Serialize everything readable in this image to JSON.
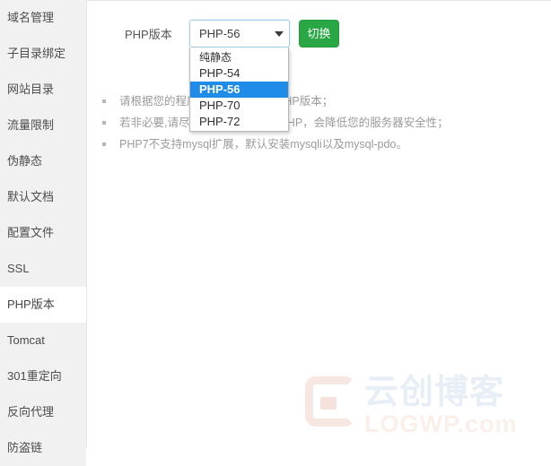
{
  "sidebar": {
    "items": [
      {
        "label": "域名管理",
        "active": false
      },
      {
        "label": "子目录绑定",
        "active": false
      },
      {
        "label": "网站目录",
        "active": false
      },
      {
        "label": "流量限制",
        "active": false
      },
      {
        "label": "伪静态",
        "active": false
      },
      {
        "label": "默认文档",
        "active": false
      },
      {
        "label": "配置文件",
        "active": false
      },
      {
        "label": "SSL",
        "active": false
      },
      {
        "label": "PHP版本",
        "active": true
      },
      {
        "label": "Tomcat",
        "active": false
      },
      {
        "label": "301重定向",
        "active": false
      },
      {
        "label": "反向代理",
        "active": false
      },
      {
        "label": "防盗链",
        "active": false
      }
    ]
  },
  "form": {
    "php_label": "PHP版本",
    "select": {
      "value": "PHP-56",
      "arrow_icon": "chevron-down-icon",
      "open": true,
      "options": [
        {
          "label": "纯静态",
          "selected": false
        },
        {
          "label": "PHP-54",
          "selected": false
        },
        {
          "label": "PHP-56",
          "selected": true
        },
        {
          "label": "PHP-70",
          "selected": false
        },
        {
          "label": "PHP-72",
          "selected": false
        }
      ]
    },
    "switch_button": "切换"
  },
  "notes": [
    "请根据您的程序需求选择合适的PHP版本；",
    "若非必要,请尽量不要使用低版本PHP，会降低您的服务器安全性；",
    "PHP7不支持mysql扩展，默认安装mysqli以及mysql-pdo。"
  ],
  "watermark": {
    "cn_text": "云创博客",
    "en_text": "LOGWP.com",
    "logo_icon": "logwp-logo-icon"
  },
  "colors": {
    "accent_green": "#2aa745",
    "highlight_blue": "#1e8ce8",
    "sidebar_bg": "#f1f1f1",
    "note_text": "#9b9b9b"
  }
}
